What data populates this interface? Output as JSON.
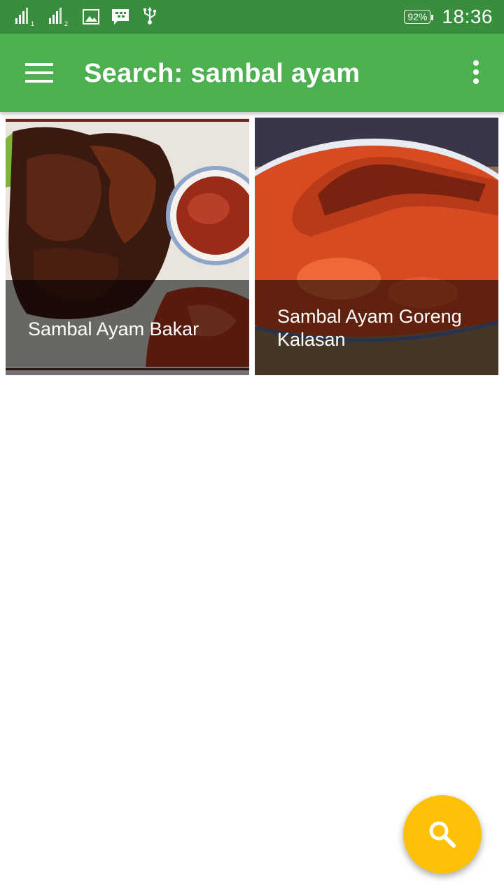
{
  "status_bar": {
    "battery": "92%",
    "time": "18:36",
    "icons": [
      "signal-sim1-icon",
      "signal-sim2-icon",
      "image-icon",
      "bbm-icon",
      "usb-icon",
      "battery-icon"
    ]
  },
  "app_bar": {
    "title": "Search: sambal ayam",
    "menu_icon": "hamburger-menu-icon",
    "overflow_icon": "more-vert-icon",
    "color": "#4caf50"
  },
  "results": [
    {
      "title": "Sambal Ayam Bakar"
    },
    {
      "title": "Sambal Ayam Goreng Kalasan"
    }
  ],
  "fab": {
    "icon": "search-icon",
    "color": "#ffc107"
  }
}
